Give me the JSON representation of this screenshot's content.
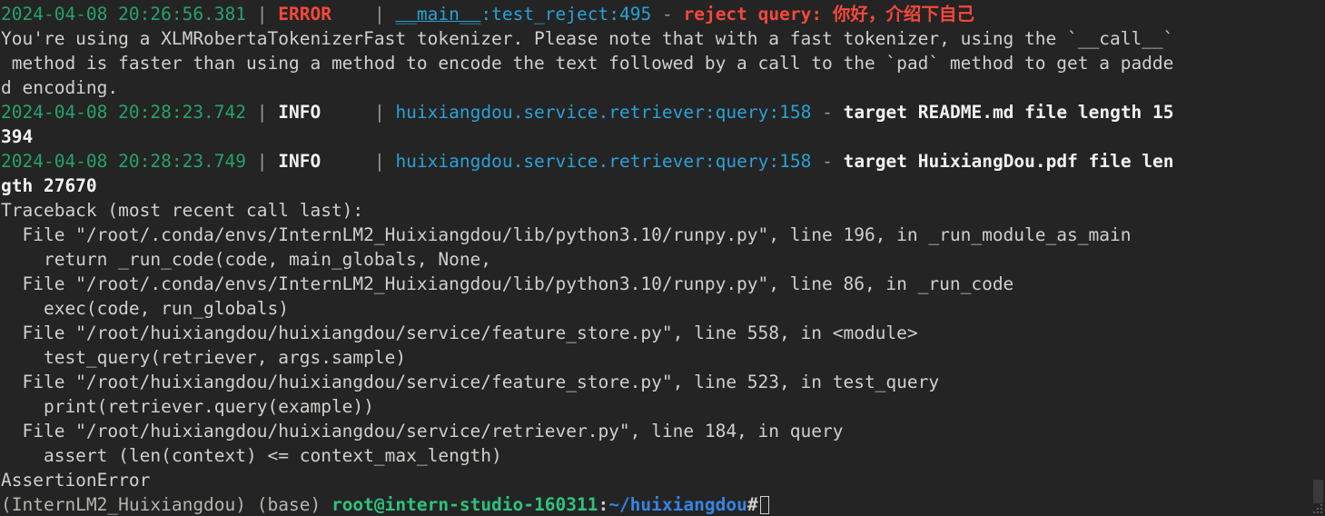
{
  "terminal": {
    "background": "#242424",
    "foreground": "#d0cfcc",
    "colors": {
      "green": "#26a269",
      "red": "#f4483c",
      "cyan": "#2aa1d6",
      "bold_white": "#f2f2f2",
      "prompt_green": "#2ec27e",
      "prompt_blue": "#3584e4"
    }
  },
  "log": {
    "entry1": {
      "timestamp": "2024-04-08 20:26:56.381",
      "sep1": " | ",
      "level": "ERROR",
      "level_pad": "   ",
      "sep2": " | ",
      "module": "__main__",
      "colon1": ":",
      "func": "test_reject",
      "colon2": ":",
      "lineno": "495",
      "dash": " - ",
      "message_en": "reject query: ",
      "message_cjk": "你好，介绍下自己"
    },
    "warning": {
      "line1": "You're using a XLMRobertaTokenizerFast tokenizer. Please note that with a fast tokenizer, using the `__call__`",
      "line2": " method is faster than using a method to encode the text followed by a call to the `pad` method to get a padde",
      "line3": "d encoding."
    },
    "entry2": {
      "timestamp": "2024-04-08 20:28:23.742",
      "sep1": " | ",
      "level": "INFO",
      "level_pad": "    ",
      "sep2": " | ",
      "module": "huixiangdou.service.retriever",
      "colon1": ":",
      "func": "query",
      "colon2": ":",
      "lineno": "158",
      "dash": " - ",
      "message": "target README.md file length 15",
      "message_wrap": "394"
    },
    "entry3": {
      "timestamp": "2024-04-08 20:28:23.749",
      "sep1": " | ",
      "level": "INFO",
      "level_pad": "    ",
      "sep2": " | ",
      "module": "huixiangdou.service.retriever",
      "colon1": ":",
      "func": "query",
      "colon2": ":",
      "lineno": "158",
      "dash": " - ",
      "message": "target HuixiangDou.pdf file len",
      "message_wrap": "gth 27670"
    }
  },
  "traceback": {
    "header": "Traceback (most recent call last):",
    "frames": [
      {
        "location": "  File \"/root/.conda/envs/InternLM2_Huixiangdou/lib/python3.10/runpy.py\", line 196, in _run_module_as_main",
        "code": "    return _run_code(code, main_globals, None,"
      },
      {
        "location": "  File \"/root/.conda/envs/InternLM2_Huixiangdou/lib/python3.10/runpy.py\", line 86, in _run_code",
        "code": "    exec(code, run_globals)"
      },
      {
        "location": "  File \"/root/huixiangdou/huixiangdou/service/feature_store.py\", line 558, in <module>",
        "code": "    test_query(retriever, args.sample)"
      },
      {
        "location": "  File \"/root/huixiangdou/huixiangdou/service/feature_store.py\", line 523, in test_query",
        "code": "    print(retriever.query(example))"
      },
      {
        "location": "  File \"/root/huixiangdou/huixiangdou/service/retriever.py\", line 184, in query",
        "code": "    assert (len(context) <= context_max_length)"
      }
    ],
    "exception": "AssertionError"
  },
  "prompt": {
    "conda_env": "(InternLM2_Huixiangdou) ",
    "base_env": "(base) ",
    "user_host": "root@intern-studio-160311",
    "colon": ":",
    "cwd": "~/huixiangdou",
    "symbol": "#"
  }
}
